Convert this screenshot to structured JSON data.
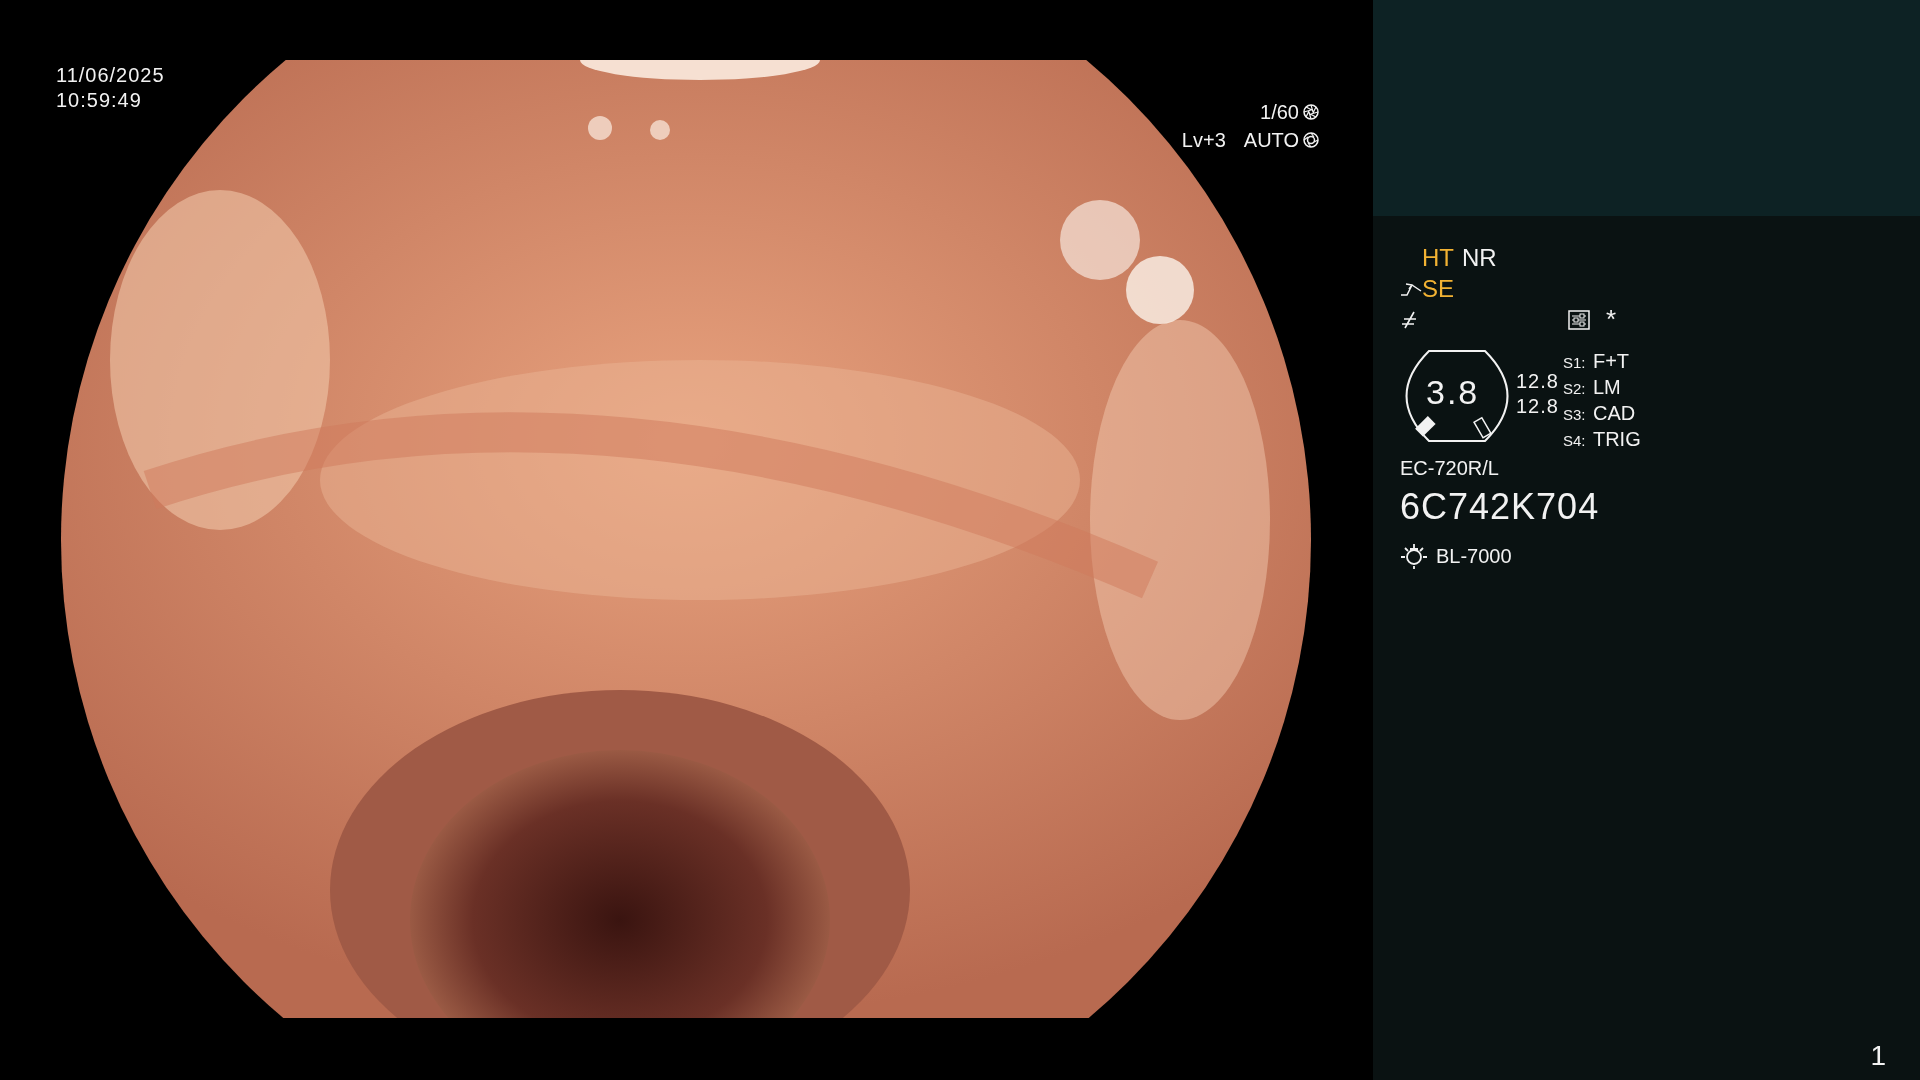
{
  "timestamp": {
    "date": "11/06/2025",
    "time": "10:59:49"
  },
  "exposure": {
    "shutter": "1/60",
    "brightness": "Lv+3",
    "mode": "AUTO"
  },
  "panel": {
    "modes": [
      {
        "label": "HT",
        "active": true
      },
      {
        "label": "NR",
        "active": false
      }
    ],
    "enhancement": {
      "label": "SE",
      "active": true
    },
    "marker": "*",
    "gauge_value": "3.8",
    "readings": [
      "12.8",
      "12.8"
    ],
    "switches": [
      {
        "key": "S1:",
        "value": "F+T"
      },
      {
        "key": "S2:",
        "value": "LM"
      },
      {
        "key": "S3:",
        "value": "CAD"
      },
      {
        "key": "S4:",
        "value": "TRIG"
      }
    ],
    "scope_model": "EC-720R/L",
    "serial": "6C742K704",
    "light_source": "BL-7000"
  },
  "page_number": "1"
}
